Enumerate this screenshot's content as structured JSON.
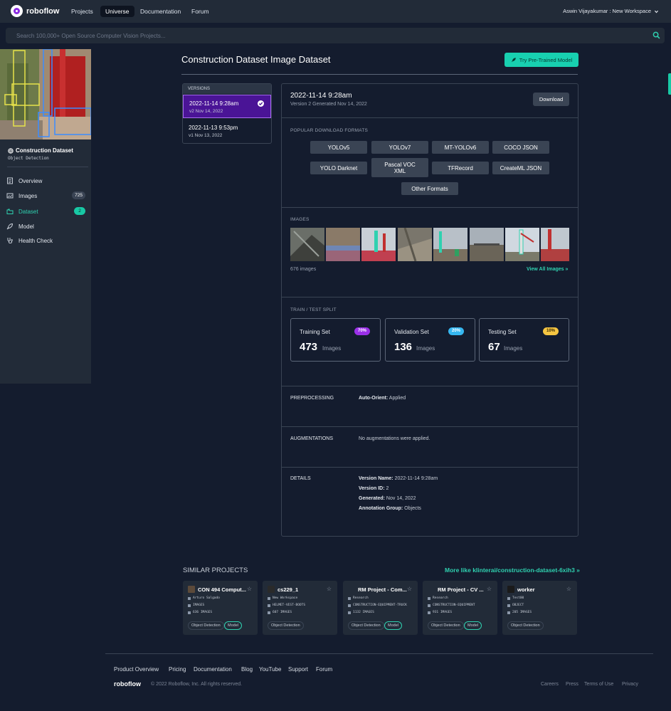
{
  "nav": {
    "brand": "roboflow",
    "links": [
      "Projects",
      "Universe",
      "Documentation",
      "Forum"
    ],
    "active": "Universe",
    "user": "Aswin Vijayakumar : New Workspace"
  },
  "search": {
    "placeholder": "Search 100,000+ Open Source Computer Vision Projects..."
  },
  "sidebar": {
    "dataset_name": "Construction Dataset",
    "dataset_type": "Object Detection",
    "items": [
      {
        "label": "Overview",
        "icon": "document-icon",
        "badge": ""
      },
      {
        "label": "Images",
        "icon": "images-icon",
        "badge": "725"
      },
      {
        "label": "Dataset",
        "icon": "folders-icon",
        "badge": "2"
      },
      {
        "label": "Model",
        "icon": "rocket-icon",
        "badge": ""
      },
      {
        "label": "Health Check",
        "icon": "stethoscope-icon",
        "badge": ""
      }
    ]
  },
  "header": {
    "title": "Construction Dataset Image Dataset",
    "try_button": "Try Pre-Trained Model"
  },
  "versions": {
    "heading": "VERSIONS",
    "items": [
      {
        "title": "2022-11-14 9:28am",
        "sub": "v2 Nov 14, 2022",
        "selected": true
      },
      {
        "title": "2022-11-13 9:53pm",
        "sub": "v1 Nov 13, 2022",
        "selected": false
      }
    ]
  },
  "version_detail": {
    "title": "2022-11-14 9:28am",
    "subtitle": "Version 2 Generated Nov 14, 2022",
    "download": "Download",
    "formats_label": "POPULAR DOWNLOAD FORMATS",
    "formats": [
      "YOLOv5",
      "YOLOv7",
      "MT-YOLOv6",
      "COCO JSON",
      "YOLO Darknet",
      "Pascal VOC XML",
      "TFRecord",
      "CreateML JSON",
      "Other Formats"
    ],
    "images_label": "IMAGES",
    "image_count": "676 images",
    "view_all": "View All Images »",
    "split_label": "TRAIN / TEST SPLIT",
    "splits": [
      {
        "name": "Training Set",
        "value": "473",
        "unit": "Images",
        "pct": "70%",
        "color": "#9b30e8"
      },
      {
        "name": "Validation Set",
        "value": "136",
        "unit": "Images",
        "pct": "20%",
        "color": "#36b7f0"
      },
      {
        "name": "Testing Set",
        "value": "67",
        "unit": "Images",
        "pct": "10%",
        "color": "#f5c542"
      }
    ],
    "preprocessing_label": "PREPROCESSING",
    "preprocessing_key": "Auto-Orient:",
    "preprocessing_val": "Applied",
    "augmentations_label": "AUGMENTATIONS",
    "augmentations_val": "No augmentations were applied.",
    "details_label": "DETAILS",
    "details": [
      {
        "k": "Version Name:",
        "v": "2022-11-14 9:28am"
      },
      {
        "k": "Version ID:",
        "v": "2"
      },
      {
        "k": "Generated:",
        "v": "Nov 14, 2022"
      },
      {
        "k": "Annotation Group:",
        "v": "Objects"
      }
    ]
  },
  "similar": {
    "title": "SIMILAR PROJECTS",
    "more": "More like klinterai/construction-dataset-6xih3 »",
    "cards": [
      {
        "title": "CON 494 Comput...",
        "owner": "Arturo Salgado",
        "class": "IMAGES",
        "count": "636 IMAGES",
        "model": true
      },
      {
        "title": "cs229_1",
        "owner": "New Workspace",
        "class": "HELMET-VEST-BOOTS",
        "count": "607 IMAGES",
        "model": false
      },
      {
        "title": "RM Project - Com...",
        "owner": "Research",
        "class": "CONSTRUCTION-EQUIPMENT-TRUCK",
        "count": "1132 IMAGES",
        "model": true
      },
      {
        "title": "RM Project - CV ...",
        "owner": "Research",
        "class": "CONSTRUCTION-EQUIPMENT",
        "count": "931 IMAGES",
        "model": true
      },
      {
        "title": "worker",
        "owner": "Test00",
        "class": "OBJECT",
        "count": "205 IMAGES",
        "model": false
      }
    ],
    "tag_od": "Object Detection",
    "tag_model": "Model"
  },
  "footer": {
    "links": [
      "Product Overview",
      "Pricing",
      "Documentation",
      "Blog",
      "YouTube",
      "Support",
      "Forum"
    ],
    "brand": "roboflow",
    "copyright": "© 2022 Roboflow, Inc. All rights reserved.",
    "right_links": [
      "Careers",
      "Press",
      "Terms of Use",
      "Privacy"
    ]
  }
}
